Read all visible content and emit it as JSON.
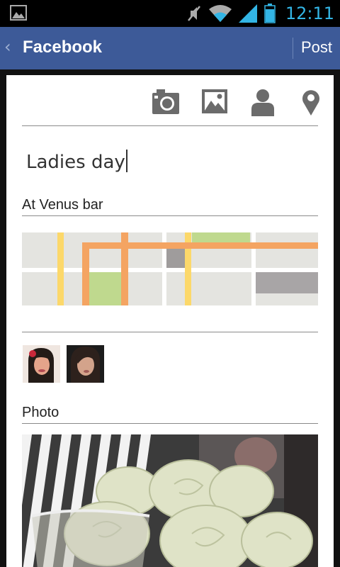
{
  "status_bar": {
    "time": "12:11",
    "icons": [
      "gallery-icon",
      "mute-icon",
      "wifi-icon",
      "signal-icon",
      "battery-icon"
    ],
    "accent_color": "#33b5e5"
  },
  "action_bar": {
    "back_glyph": "‹",
    "title": "Facebook",
    "post_label": "Post",
    "bg_color": "#3d5a98"
  },
  "toolbar": {
    "icons": [
      "camera-icon",
      "image-icon",
      "person-icon",
      "location-pin-icon"
    ]
  },
  "composer": {
    "text": "Ladies day"
  },
  "location": {
    "label": "At Venus bar"
  },
  "tagged": {
    "avatars": [
      "friend-avatar-1",
      "friend-avatar-2"
    ]
  },
  "photo": {
    "label": "Photo"
  }
}
